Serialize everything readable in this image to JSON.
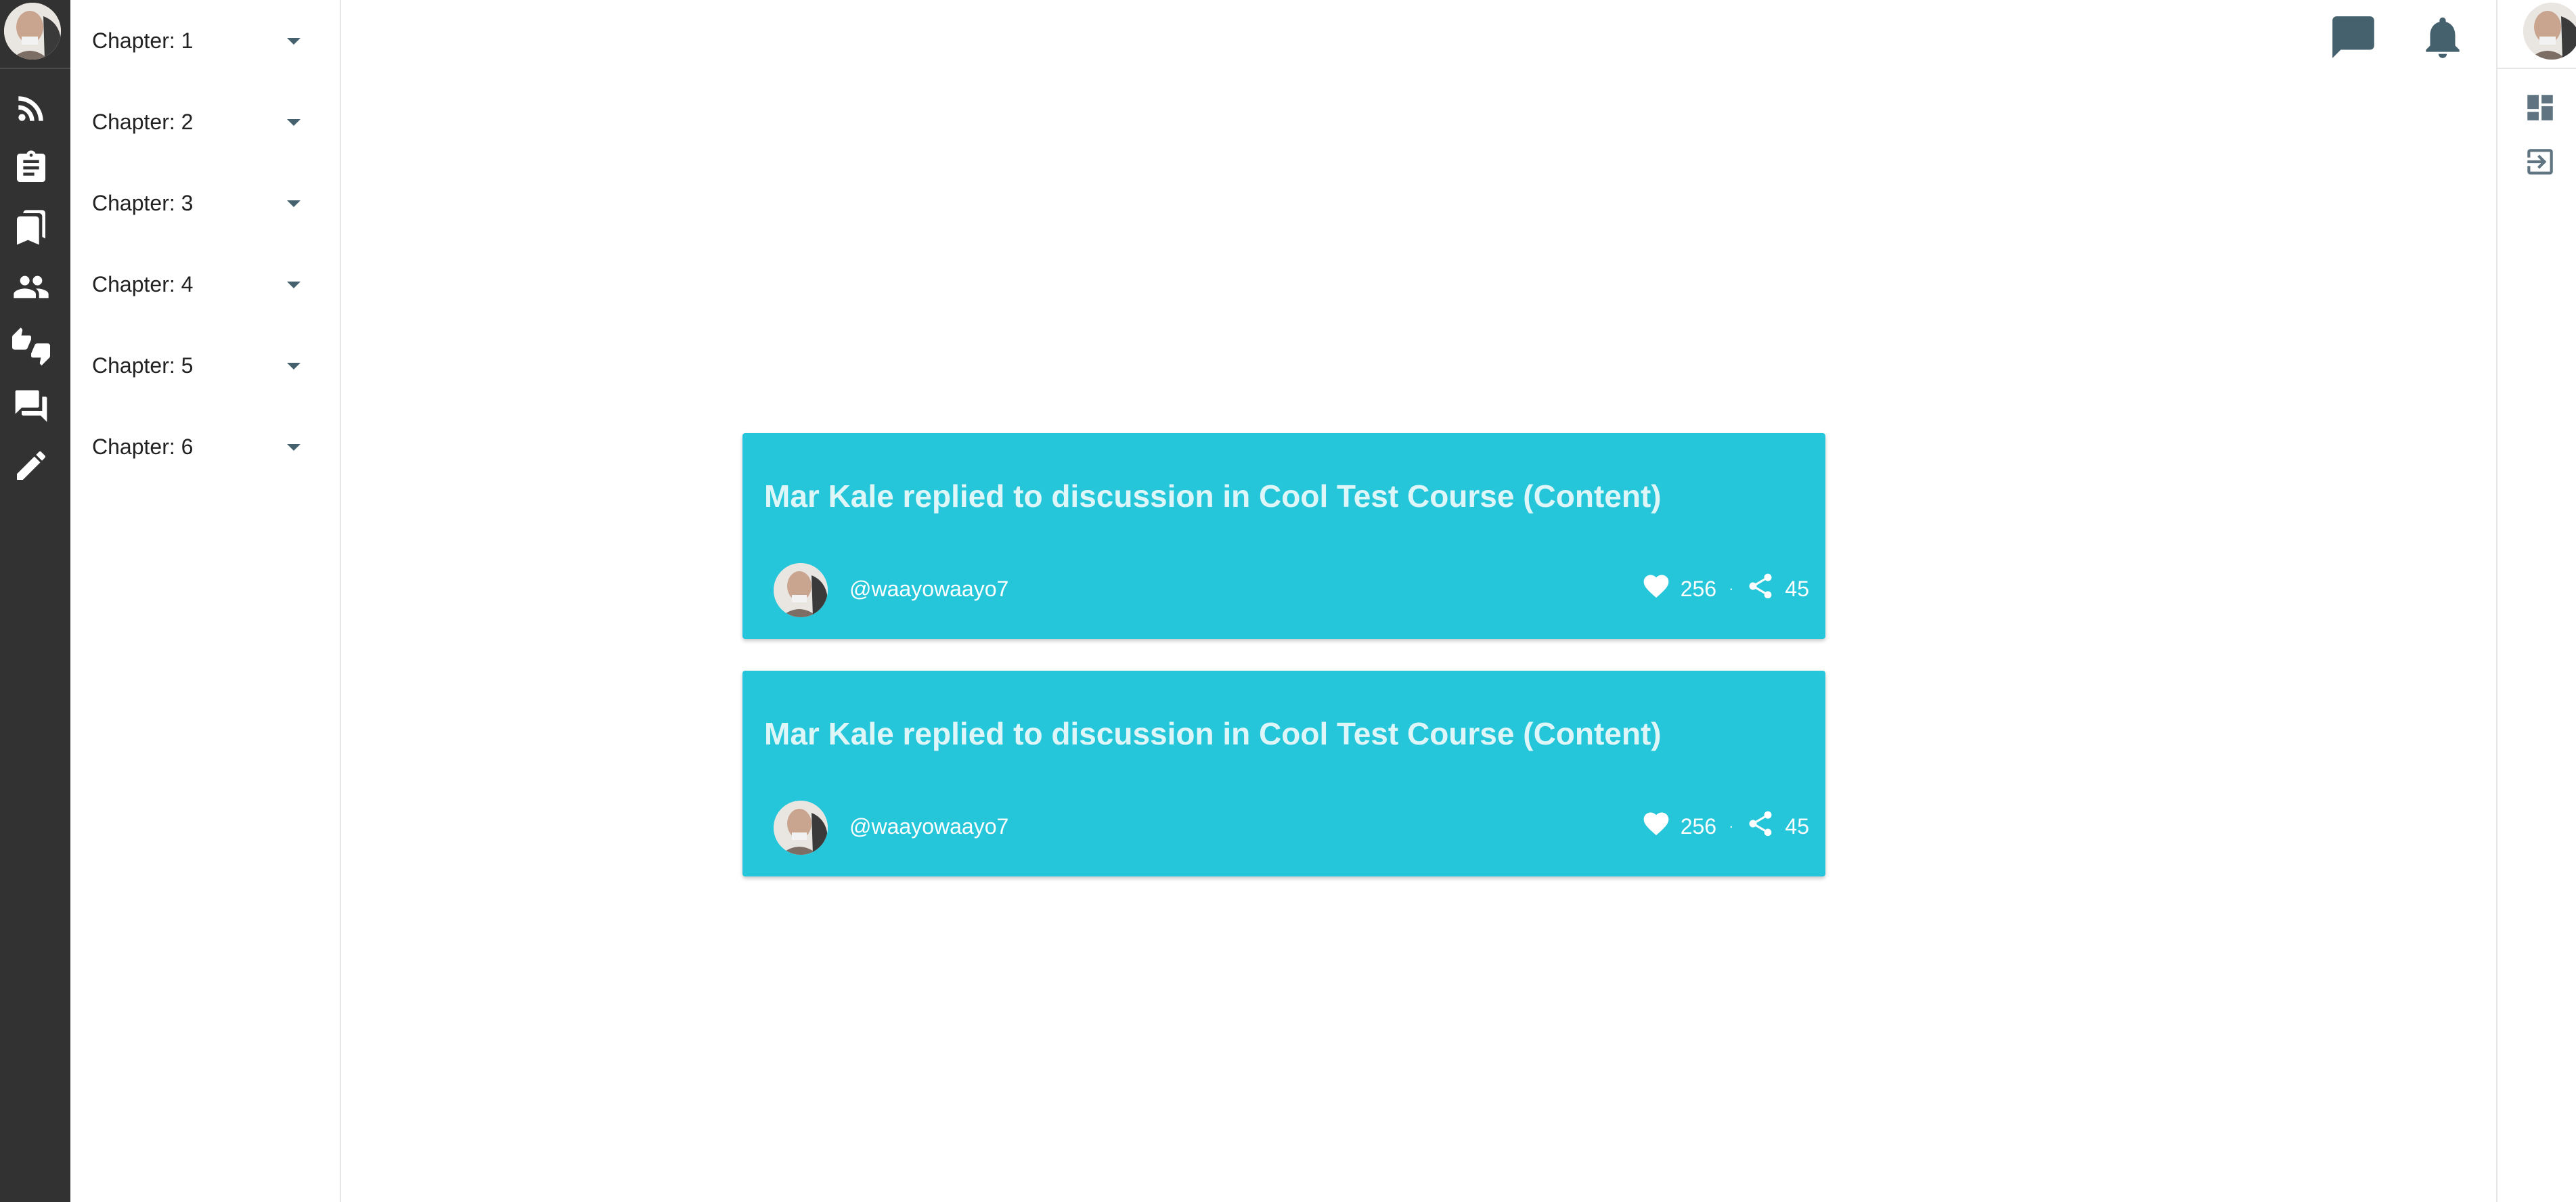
{
  "nav_rail": {
    "icons": [
      "rss-feed-icon",
      "assignment-icon",
      "bookmarks-icon",
      "people-icon",
      "thumbs-up-down-icon",
      "forum-icon",
      "edit-pencil-icon"
    ]
  },
  "chapters": [
    {
      "label": "Chapter: 1"
    },
    {
      "label": "Chapter: 2"
    },
    {
      "label": "Chapter: 3"
    },
    {
      "label": "Chapter: 4"
    },
    {
      "label": "Chapter: 5"
    },
    {
      "label": "Chapter: 6"
    }
  ],
  "header": {
    "icons": [
      "chat-message-icon",
      "notification-bell-icon"
    ]
  },
  "right_rail": {
    "icons": [
      "dashboard-icon",
      "logout-icon"
    ]
  },
  "cards": [
    {
      "title": "Mar Kale replied to discussion in Cool Test Course (Content)",
      "handle": "@waayowaayo7",
      "likes": "256",
      "shares": "45"
    },
    {
      "title": "Mar Kale replied to discussion in Cool Test Course (Content)",
      "handle": "@waayowaayo7",
      "likes": "256",
      "shares": "45"
    }
  ],
  "colors": {
    "card_bg": "#26c6da",
    "rail_bg": "#323232",
    "header_icon": "#45616e"
  }
}
